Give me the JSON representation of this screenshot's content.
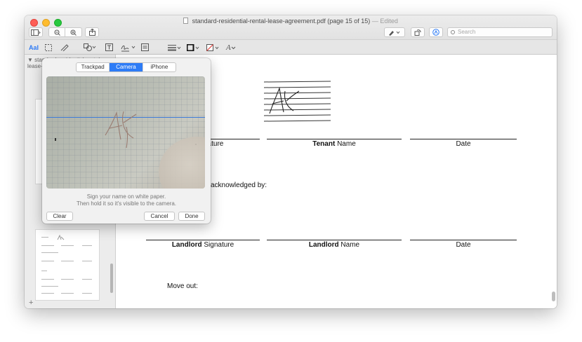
{
  "window": {
    "title": "standard-residential-rental-lease-agreement.pdf (page 15 of 15)",
    "edited": "— Edited"
  },
  "toolbar": {
    "search_placeholder": "Search",
    "icons": [
      "sidebar-icon",
      "zoom-out-icon",
      "zoom-in-icon",
      "share-icon",
      "highlight-pen-icon",
      "rotate-icon",
      "markup-icon"
    ]
  },
  "markup": {
    "text_tool": "AaI",
    "font_tool": "A"
  },
  "sidebar": {
    "header": "standard-residential-rental-lease-agreement"
  },
  "document": {
    "row1": {
      "signature_suffix": "nature",
      "name_bold": "Tenant",
      "name_suffix": " Name",
      "date": "Date"
    },
    "acknowledged": "acknowledged by:",
    "row2": {
      "sig_bold": "Landlord",
      "sig_suffix": " Signature",
      "name_bold": "Landlord",
      "name_suffix": " Name",
      "date": "Date"
    },
    "move_out": "Move out:"
  },
  "popover": {
    "tabs": [
      "Trackpad",
      "Camera",
      "iPhone"
    ],
    "active_tab": "Camera",
    "instruction_1": "Sign your name on white paper.",
    "instruction_2": "Then hold it so it's visible to the camera.",
    "clear": "Clear",
    "cancel": "Cancel",
    "done": "Done"
  },
  "colors": {
    "accent": "#2e7cf6"
  }
}
